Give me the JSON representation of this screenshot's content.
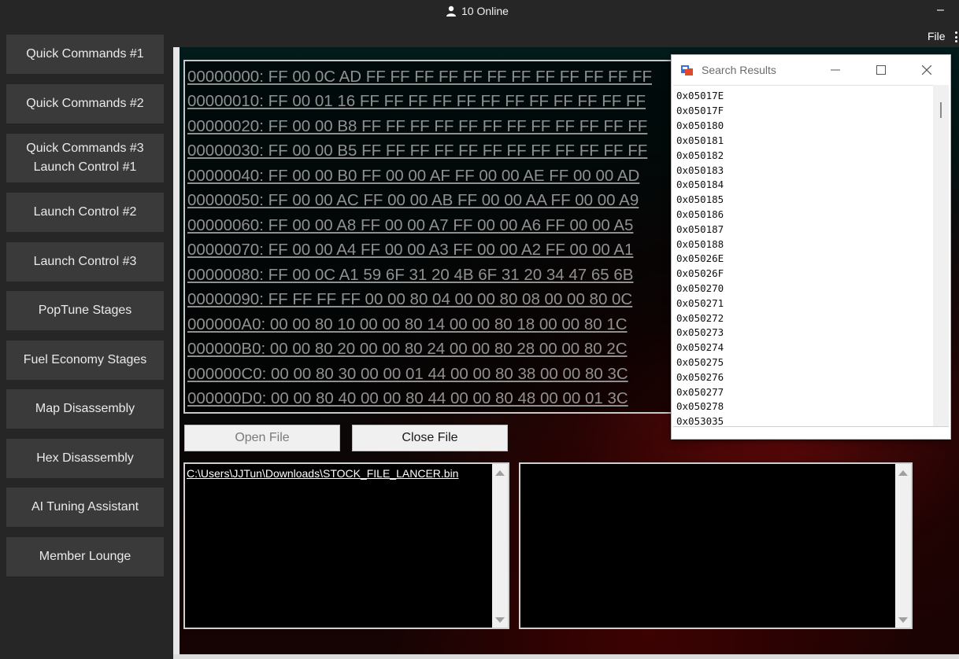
{
  "header": {
    "online_text": "10 Online",
    "minimize_label": "–",
    "file_menu_label": "File"
  },
  "sidebar": {
    "items": [
      {
        "label": "Quick Commands #1"
      },
      {
        "label": "Quick Commands #2"
      },
      {
        "label_line1": "Quick Commands #3",
        "label_line2": "Launch Control #1"
      },
      {
        "label": "Launch Control #2"
      },
      {
        "label": "Launch Control #3"
      },
      {
        "label": "PopTune Stages"
      },
      {
        "label": "Fuel Economy Stages"
      },
      {
        "label": "Map Disassembly"
      },
      {
        "label": "Hex Disassembly"
      },
      {
        "label": "AI Tuning Assistant"
      },
      {
        "label": "Member Lounge"
      }
    ]
  },
  "hex_view": {
    "rows": [
      "00000000: FF 00 0C AD FF FF FF FF FF FF FF FF FF FF FF FF",
      "00000010: FF 00 01 16 FF FF FF FF FF FF FF FF FF FF FF FF",
      "00000020: FF 00 00 B8 FF FF FF FF FF FF FF FF FF FF FF FF",
      "00000030: FF 00 00 B5 FF FF FF FF FF FF FF FF FF FF FF FF",
      "00000040: FF 00 00 B0 FF 00 00 AF FF 00 00 AE FF 00 00 AD",
      "00000050: FF 00 00 AC FF 00 00 AB FF 00 00 AA FF 00 00 A9",
      "00000060: FF 00 00 A8 FF 00 00 A7 FF 00 00 A6 FF 00 00 A5",
      "00000070: FF 00 00 A4 FF 00 00 A3 FF 00 00 A2 FF 00 00 A1",
      "00000080: FF 00 0C A1 59 6F 31 20 4B 6F 31 20 34 47 65 6B",
      "00000090: FF FF FF FF 00 00 80 04 00 00 80 08 00 00 80 0C",
      "000000A0: 00 00 80 10 00 00 80 14 00 00 80 18 00 00 80 1C",
      "000000B0: 00 00 80 20 00 00 80 24 00 00 80 28 00 00 80 2C",
      "000000C0: 00 00 80 30 00 00 01 44 00 00 80 38 00 00 80 3C",
      "000000D0: 00 00 80 40 00 00 80 44 00 00 80 48 00 00 01 3C"
    ]
  },
  "buttons": {
    "open_file": "Open File",
    "close_file": "Close File"
  },
  "file_list": {
    "path": "C:\\Users\\JJTun\\Downloads\\STOCK_FILE_LANCER.bin"
  },
  "search_window": {
    "title": "Search Results",
    "results": [
      "0x05017E",
      "0x05017F",
      "0x050180",
      "0x050181",
      "0x050182",
      "0x050183",
      "0x050184",
      "0x050185",
      "0x050186",
      "0x050187",
      "0x050188",
      "0x05026E",
      "0x05026F",
      "0x050270",
      "0x050271",
      "0x050272",
      "0x050273",
      "0x050274",
      "0x050275",
      "0x050276",
      "0x050277",
      "0x050278",
      "0x053035"
    ]
  },
  "colors": {
    "sidebar_button_bg": "#3a3a3a",
    "hex_text": "#909090",
    "window_bg": "#262626"
  }
}
